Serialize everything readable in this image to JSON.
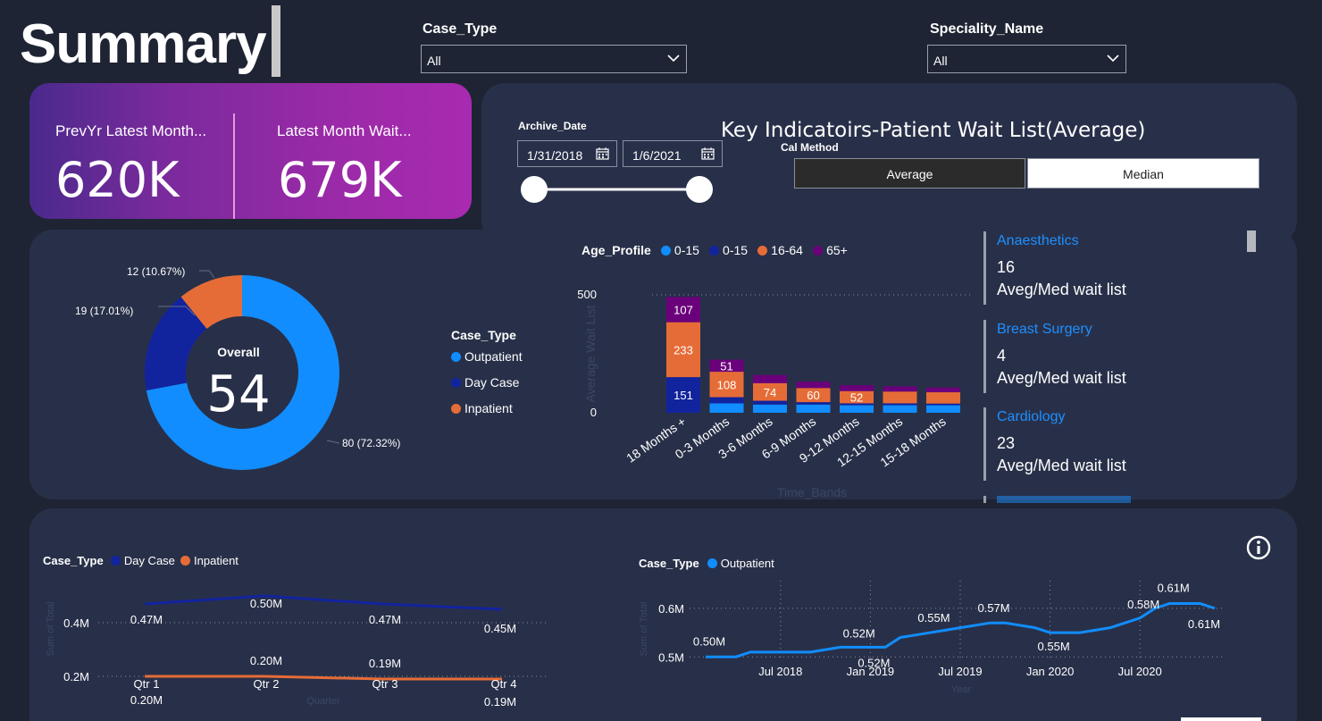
{
  "page": {
    "title": "Summary"
  },
  "filters": {
    "case_type": {
      "label": "Case_Type",
      "value": "All"
    },
    "speciality": {
      "label": "Speciality_Name",
      "value": "All"
    }
  },
  "kpis": [
    {
      "label": "PrevYr Latest Month...",
      "value": "620K"
    },
    {
      "label": "Latest Month Wait...",
      "value": "679K"
    }
  ],
  "archive": {
    "label": "Archive_Date",
    "start": "1/31/2018",
    "end": "1/6/2021"
  },
  "indicators": {
    "title": "Key Indicatoirs-Patient Wait List(Average)",
    "cal_method_label": "Cal Method",
    "buttons": [
      "Average",
      "Median"
    ],
    "selected": "Average"
  },
  "donut": {
    "center_label": "Overall",
    "center_value": "54",
    "legend_title": "Case_Type",
    "slices": [
      {
        "name": "Outpatient",
        "value": 80,
        "label": "80 (72.32%)",
        "color": "#118dff"
      },
      {
        "name": "Day Case",
        "value": 19,
        "label": "19 (17.01%)",
        "color": "#12239e"
      },
      {
        "name": "Inpatient",
        "value": 12,
        "label": "12 (10.67%)",
        "color": "#e66c37"
      }
    ]
  },
  "stacked": {
    "legend_title": "Age_Profile",
    "legend": [
      {
        "name": "0-15",
        "color": "#118dff"
      },
      {
        "name": "0-15",
        "color": "#12239e"
      },
      {
        "name": "16-64",
        "color": "#e66c37"
      },
      {
        "name": "65+",
        "color": "#6b007b"
      }
    ],
    "ylabel": "Average Wait List",
    "xlabel": "Time_Bands",
    "yticks": [
      "500",
      "0"
    ],
    "categories": [
      "18 Months +",
      "0-3 Months",
      "3-6 Months",
      "6-9 Months",
      "9-12 Months",
      "12-15 Months",
      "15-18 Months"
    ]
  },
  "specialities": [
    {
      "name": "Anaesthetics",
      "value": "16",
      "sub": "Aveg/Med wait list"
    },
    {
      "name": "Breast Surgery",
      "value": "4",
      "sub": "Aveg/Med wait list"
    },
    {
      "name": "Cardiology",
      "value": "23",
      "sub": "Aveg/Med wait list"
    }
  ],
  "quarter_chart": {
    "legend_title": "Case_Type",
    "legend": [
      {
        "name": "Day Case",
        "color": "#12239e"
      },
      {
        "name": "Inpatient",
        "color": "#e66c37"
      }
    ],
    "ylabel": "Sum of Total",
    "xlabel": "Quarter",
    "yticks": [
      "0.4M",
      "0.2M"
    ],
    "categories": [
      "Qtr 1",
      "Qtr 2",
      "Qtr 3",
      "Qtr 4"
    ],
    "day_case_labels": [
      "0.47M",
      "0.50M",
      "0.47M",
      "0.45M"
    ],
    "inpatient_labels": [
      "0.20M",
      "0.20M",
      "0.19M",
      "0.19M"
    ]
  },
  "trend_chart": {
    "legend_title": "Case_Type",
    "legend": [
      {
        "name": "Outpatient",
        "color": "#118dff"
      }
    ],
    "ylabel": "Sum of Total",
    "xlabel": "Year",
    "yticks": [
      "0.6M",
      "0.5M"
    ],
    "xticks": [
      "Jul 2018",
      "Jan 2019",
      "Jul 2019",
      "Jan 2020",
      "Jul 2020"
    ],
    "labels": [
      "0.50M",
      "0.52M",
      "0.52M",
      "0.55M",
      "0.57M",
      "0.55M",
      "0.58M",
      "0.61M",
      "0.61M"
    ]
  },
  "chart_data": [
    {
      "type": "pie",
      "categories": [
        "Outpatient",
        "Day Case",
        "Inpatient"
      ],
      "values": [
        80,
        19,
        12
      ],
      "title": "",
      "center": "Overall 54"
    },
    {
      "type": "bar",
      "stacked": true,
      "categories": [
        "18 Months +",
        "0-3 Months",
        "3-6 Months",
        "6-9 Months",
        "9-12 Months",
        "12-15 Months",
        "15-18 Months"
      ],
      "series": [
        {
          "name": "0-15",
          "values": [
            0,
            40,
            35,
            35,
            32,
            32,
            32
          ]
        },
        {
          "name": "0-15",
          "values": [
            151,
            26,
            16,
            10,
            8,
            8,
            7
          ]
        },
        {
          "name": "16-64",
          "values": [
            233,
            108,
            74,
            60,
            52,
            50,
            48
          ]
        },
        {
          "name": "65+",
          "values": [
            107,
            51,
            35,
            27,
            25,
            22,
            20
          ]
        }
      ],
      "xlabel": "Time_Bands",
      "ylabel": "Average Wait List",
      "ylim": [
        0,
        500
      ]
    },
    {
      "type": "line",
      "categories": [
        "Qtr 1",
        "Qtr 2",
        "Qtr 3",
        "Qtr 4"
      ],
      "series": [
        {
          "name": "Day Case",
          "values": [
            0.47,
            0.5,
            0.47,
            0.45
          ]
        },
        {
          "name": "Inpatient",
          "values": [
            0.2,
            0.2,
            0.19,
            0.19
          ]
        }
      ],
      "xlabel": "Quarter",
      "ylabel": "Sum of Total",
      "ylim": [
        0.15,
        0.55
      ]
    },
    {
      "type": "line",
      "x": [
        "2018-02",
        "2018-03",
        "2018-04",
        "2018-05",
        "2018-06",
        "2018-07",
        "2018-08",
        "2018-09",
        "2018-10",
        "2018-11",
        "2018-12",
        "2019-01",
        "2019-02",
        "2019-03",
        "2019-04",
        "2019-05",
        "2019-06",
        "2019-07",
        "2019-08",
        "2019-09",
        "2019-10",
        "2019-11",
        "2019-12",
        "2020-01",
        "2020-02",
        "2020-03",
        "2020-04",
        "2020-05",
        "2020-06",
        "2020-07",
        "2020-08",
        "2020-09",
        "2020-10",
        "2020-11",
        "2020-12"
      ],
      "series": [
        {
          "name": "Outpatient",
          "values": [
            0.5,
            0.5,
            0.5,
            0.51,
            0.51,
            0.51,
            0.51,
            0.51,
            0.515,
            0.52,
            0.52,
            0.52,
            0.52,
            0.54,
            0.545,
            0.55,
            0.555,
            0.56,
            0.565,
            0.57,
            0.57,
            0.565,
            0.56,
            0.55,
            0.55,
            0.55,
            0.555,
            0.56,
            0.57,
            0.58,
            0.6,
            0.61,
            0.61,
            0.61,
            0.6
          ]
        }
      ],
      "xlabel": "Year",
      "ylabel": "Sum of Total",
      "ylim": [
        0.495,
        0.62
      ]
    }
  ]
}
